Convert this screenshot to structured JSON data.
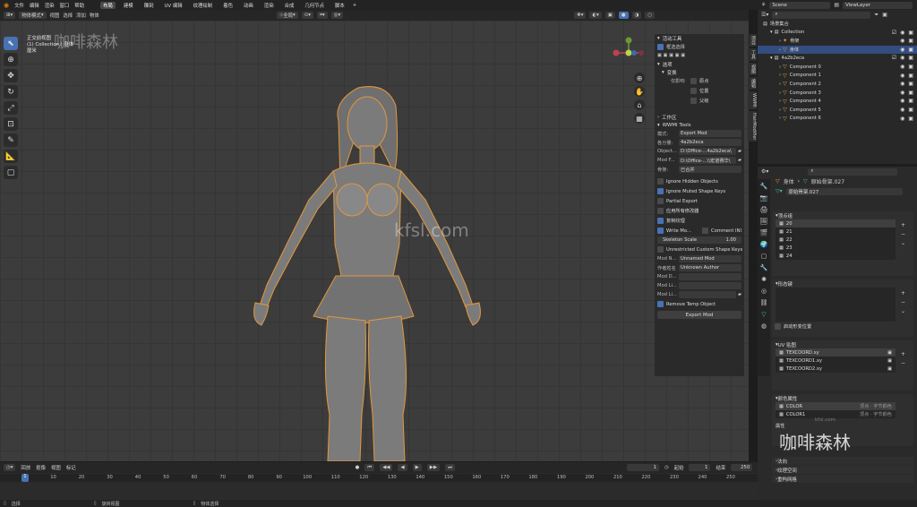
{
  "menu": {
    "items": [
      "文件",
      "编辑",
      "渲染",
      "窗口",
      "帮助"
    ],
    "workspaces": [
      "布局",
      "建模",
      "雕刻",
      "UV 编辑",
      "纹理绘制",
      "着色",
      "动画",
      "渲染",
      "合成",
      "几何节点",
      "脚本"
    ],
    "active_workspace": "布局",
    "scene": "Scene",
    "view_layer": "ViewLayer"
  },
  "viewport_header": {
    "mode": "物体模式",
    "menus": [
      "视图",
      "选择",
      "添加",
      "物体"
    ],
    "orientation": "全局",
    "options": "选项"
  },
  "viewport_overlay": {
    "line1": "正交前视图",
    "line2": "(1) Collection | 身体",
    "line3": "厘米"
  },
  "watermarks": {
    "top_left": "咖啡森林",
    "center": "kfsl.com",
    "bottom_right": "咖啡森林",
    "bottom_right_small": "kfsl.com"
  },
  "npanel": {
    "active_tool_title": "活动工具",
    "select_box": "框选选择",
    "options_title": "选项",
    "transform_title": "变换",
    "affect_only": "仅影响",
    "origins": "原点",
    "locations": "位置",
    "parents": "父级",
    "workspace_title": "工作区",
    "wwmi_title": "WWMI Tools",
    "mode_label": "模式:",
    "mode_value": "Export Mod",
    "component_label": "各分量:",
    "component_value": "4a2b2eca",
    "object_label": "Object...",
    "object_value": "D:\\Office-...4a2b2eca\\",
    "modfolder_label": "Mod F...",
    "modfolder_value": "D:\\Office-...\\\\宏道赛华\\",
    "merge_label": "骨架:",
    "merge_value": "已合并",
    "ignore_hidden": "Ignore Hidden Objects",
    "ignore_muted": "Ignore Muted Shape Keys",
    "partial_export": "Partial Export",
    "apply_modifiers": "应用所有修改器",
    "copy_textures": "复制纹理",
    "write_mod": "Write Mo...",
    "comment_ini": "Comment INI",
    "skeleton_scale_label": "Skeleton Scale",
    "skeleton_scale_value": "1.00",
    "unrestricted_keys": "Unrestricted Custom Shape Keys",
    "mod_name_label": "Mod N...",
    "mod_name_value": "Unnamed Mod",
    "author_label": "作者姓名",
    "author_value": "Unknown Author",
    "mod_d_label": "Mod D...",
    "mod_l1_label": "Mod Li...",
    "mod_l2_label": "Mod Li...",
    "remove_temp": "Remove Temp Object",
    "export_button": "Export Mod"
  },
  "sidetabs": [
    "项目",
    "工具",
    "视图",
    "编辑",
    "WWMI",
    "HairModifier"
  ],
  "outliner": {
    "search_placeholder": "",
    "root": "场景集合",
    "collection": "Collection",
    "items_in_collection": [
      "骨架",
      "身体"
    ],
    "group": "4a2b2eca",
    "components": [
      "Component 0",
      "Component 1",
      "Component 2",
      "Component 3",
      "Component 4",
      "Component 5",
      "Component 6"
    ]
  },
  "properties": {
    "breadcrumb_obj": "身体",
    "breadcrumb_mesh": "原始骨架.027",
    "mesh_name": "原始骨架.027",
    "vertex_groups_title": "顶点组",
    "vertex_groups": [
      "20",
      "21",
      "22",
      "23",
      "24"
    ],
    "shape_keys_title": "形态键",
    "shape_key_option": "启动形变位置",
    "uv_title": "UV 贴图",
    "uv_maps": [
      "TEXCOORD.xy",
      "TEXCOORD1.xy",
      "TEXCOORD2.xy"
    ],
    "color_title": "颜色属性",
    "color_attrs": [
      "COLOR",
      "COLOR1"
    ],
    "color_attr_info": "顶点 · 字节颜色",
    "sections": [
      "法向",
      "纹理空间",
      "重构网格"
    ],
    "section_extra": "属性"
  },
  "timeline": {
    "menus": [
      "回放",
      "抠像",
      "视图",
      "标记"
    ],
    "current_frame": "1",
    "start_label": "起始",
    "start": "1",
    "end_label": "结束",
    "end": "250",
    "ticks": [
      "0",
      "10",
      "20",
      "30",
      "40",
      "50",
      "60",
      "70",
      "80",
      "90",
      "100",
      "110",
      "120",
      "130",
      "140",
      "150",
      "160",
      "170",
      "180",
      "190",
      "200",
      "210",
      "220",
      "230",
      "240",
      "250"
    ],
    "playhead": "1"
  },
  "status": {
    "select": "选择",
    "rotate": "旋转视图",
    "context": "物体选择"
  }
}
